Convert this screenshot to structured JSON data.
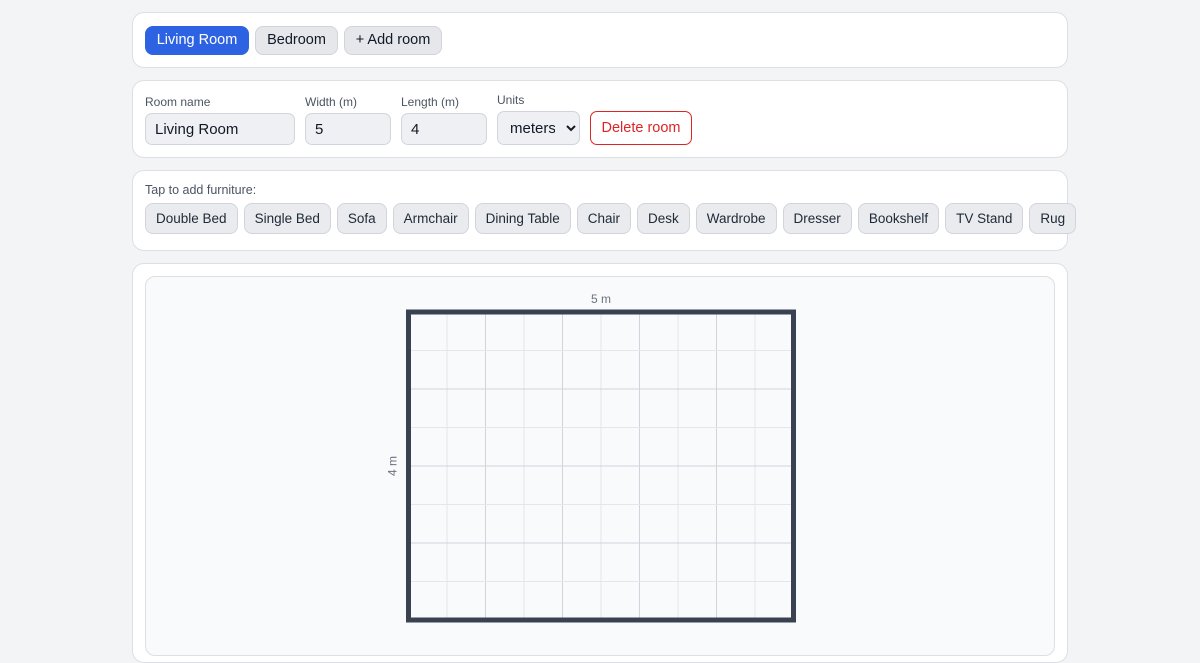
{
  "rooms": {
    "tabs": [
      {
        "label": "Living Room",
        "active": true
      },
      {
        "label": "Bedroom",
        "active": false
      }
    ],
    "add_label": "+ Add room"
  },
  "room_form": {
    "name_label": "Room name",
    "name_value": "Living Room",
    "width_label": "Width (m)",
    "width_value": "5",
    "length_label": "Length (m)",
    "length_value": "4",
    "units_label": "Units",
    "units_selected": "meters",
    "delete_label": "Delete room"
  },
  "furniture": {
    "hint": "Tap to add furniture:",
    "items": [
      "Double Bed",
      "Single Bed",
      "Sofa",
      "Armchair",
      "Dining Table",
      "Chair",
      "Desk",
      "Wardrobe",
      "Dresser",
      "Bookshelf",
      "TV Stand",
      "Rug"
    ]
  },
  "plan": {
    "width_label": "5 m",
    "length_label": "4 m",
    "width_m": 5,
    "length_m": 4,
    "colors": {
      "wall": "#3a4150",
      "grid_minor": "#e3e6ec",
      "grid_major": "#cfd4dd"
    }
  }
}
